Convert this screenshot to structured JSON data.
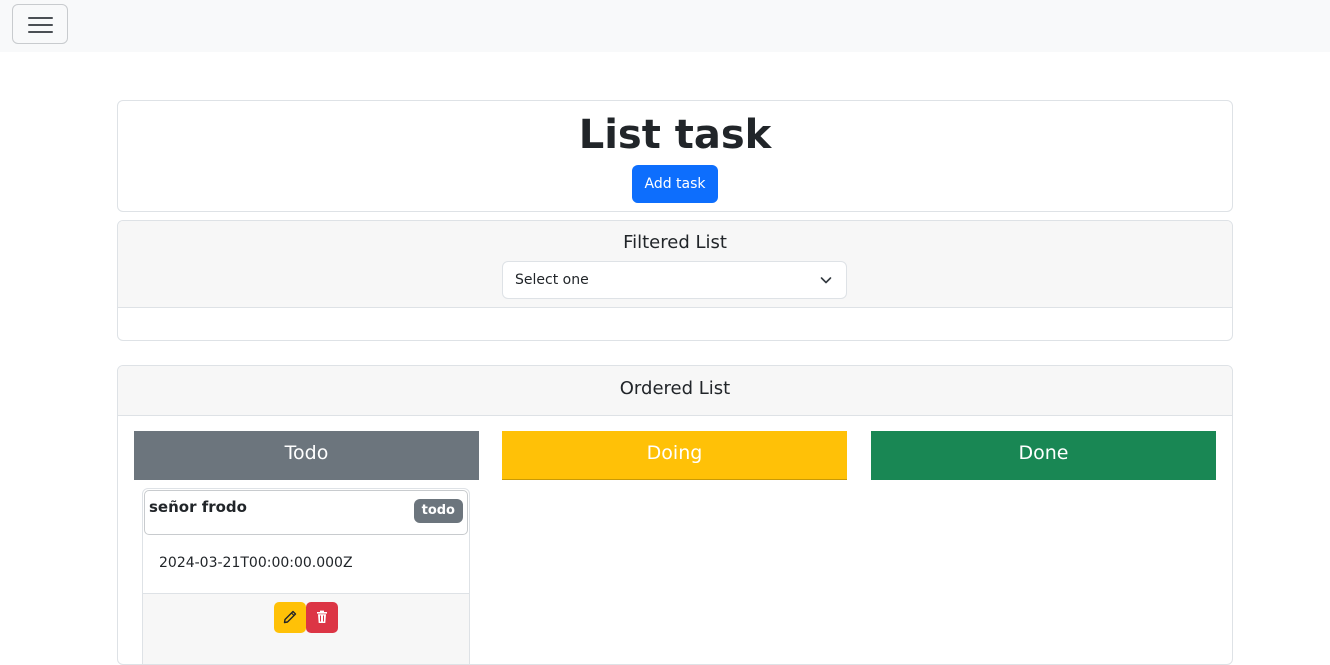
{
  "navbar": {
    "toggler_icon": "hamburger-menu-icon"
  },
  "header": {
    "title": "List task",
    "add_button_label": "Add task"
  },
  "filter": {
    "title": "Filtered List",
    "select_value": "Select one"
  },
  "ordered": {
    "title": "Ordered List",
    "columns": [
      {
        "label": "Todo",
        "color": "#6c757d"
      },
      {
        "label": "Doing",
        "color": "#ffc107"
      },
      {
        "label": "Done",
        "color": "#198754"
      }
    ],
    "tasks": [
      {
        "name": "señor frodo",
        "status": "todo",
        "date": "2024-03-21T00:00:00.000Z",
        "edit_icon": "pencil-icon",
        "delete_icon": "trash-icon"
      }
    ]
  },
  "colors": {
    "primary": "#0d6efd",
    "secondary": "#6c757d",
    "warning": "#ffc107",
    "success": "#198754",
    "danger": "#dc3545"
  }
}
